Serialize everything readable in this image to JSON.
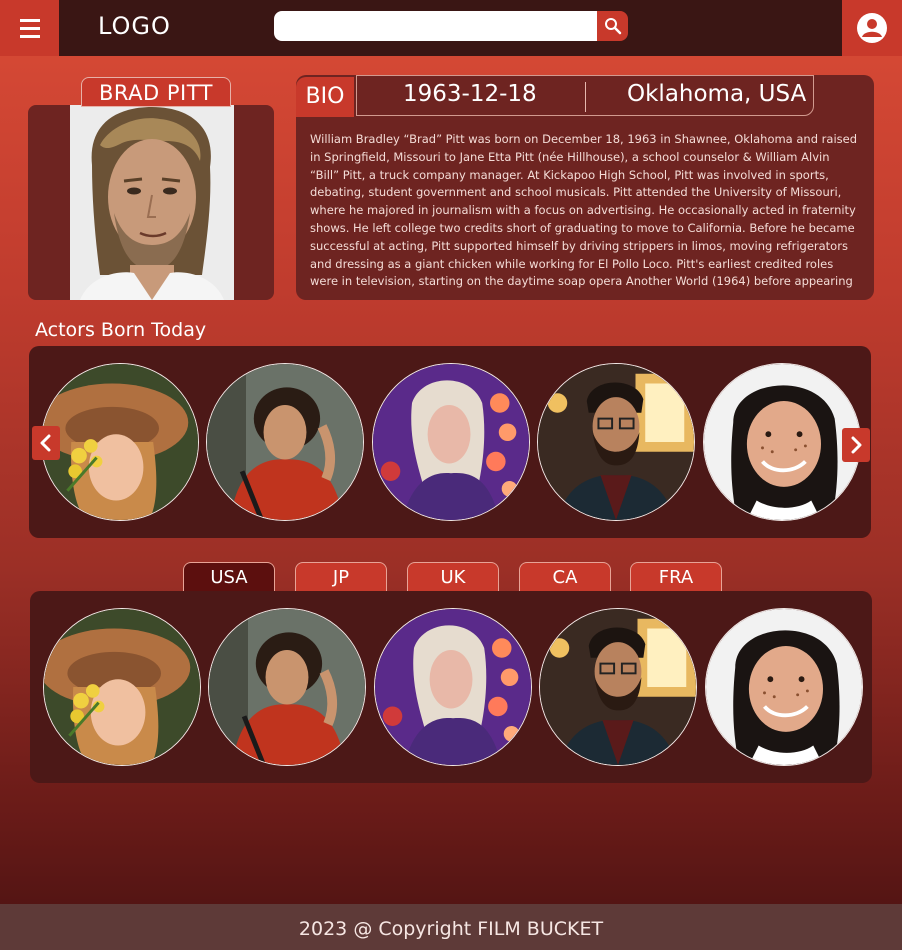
{
  "header": {
    "logo": "LOGO",
    "search_placeholder": ""
  },
  "actor": {
    "name": "BRAD PITT"
  },
  "bio": {
    "label": "BIO",
    "dob": "1963-12-18",
    "birthplace": "Oklahoma, USA",
    "text": "William Bradley “Brad” Pitt was born on December 18, 1963 in Shawnee, Oklahoma and raised in Springfield, Missouri to Jane Etta Pitt (née Hillhouse), a school counselor & William Alvin “Bill” Pitt, a truck company manager.  At Kickapoo High School, Pitt was involved in sports, debating, student government and school musicals. Pitt attended the University of Missouri, where he majored in journalism with a focus on advertising. He occasionally acted in fraternity shows. He left college two credits short of graduating to move to California. Before he became successful at acting, Pitt supported himself by driving strippers in limos, moving refrigerators and dressing as a giant chicken while working for El Pollo Loco. Pitt's earliest credited roles were in television, starting on the daytime soap opera Another World (1964) before appearing in the recurring role of Randy on the"
  },
  "born_today": {
    "title": "Actors Born Today"
  },
  "tabs": [
    "USA",
    "JP",
    "UK",
    "CA",
    "FRA"
  ],
  "active_tab": "USA",
  "footer": {
    "text": "2023 @ Copyright FILM BUCKET"
  },
  "colors": {
    "accent": "#c8392b",
    "header_bg": "#3a1614",
    "panel_bg": "#4c1817",
    "active_tab": "#5c0f0e"
  }
}
